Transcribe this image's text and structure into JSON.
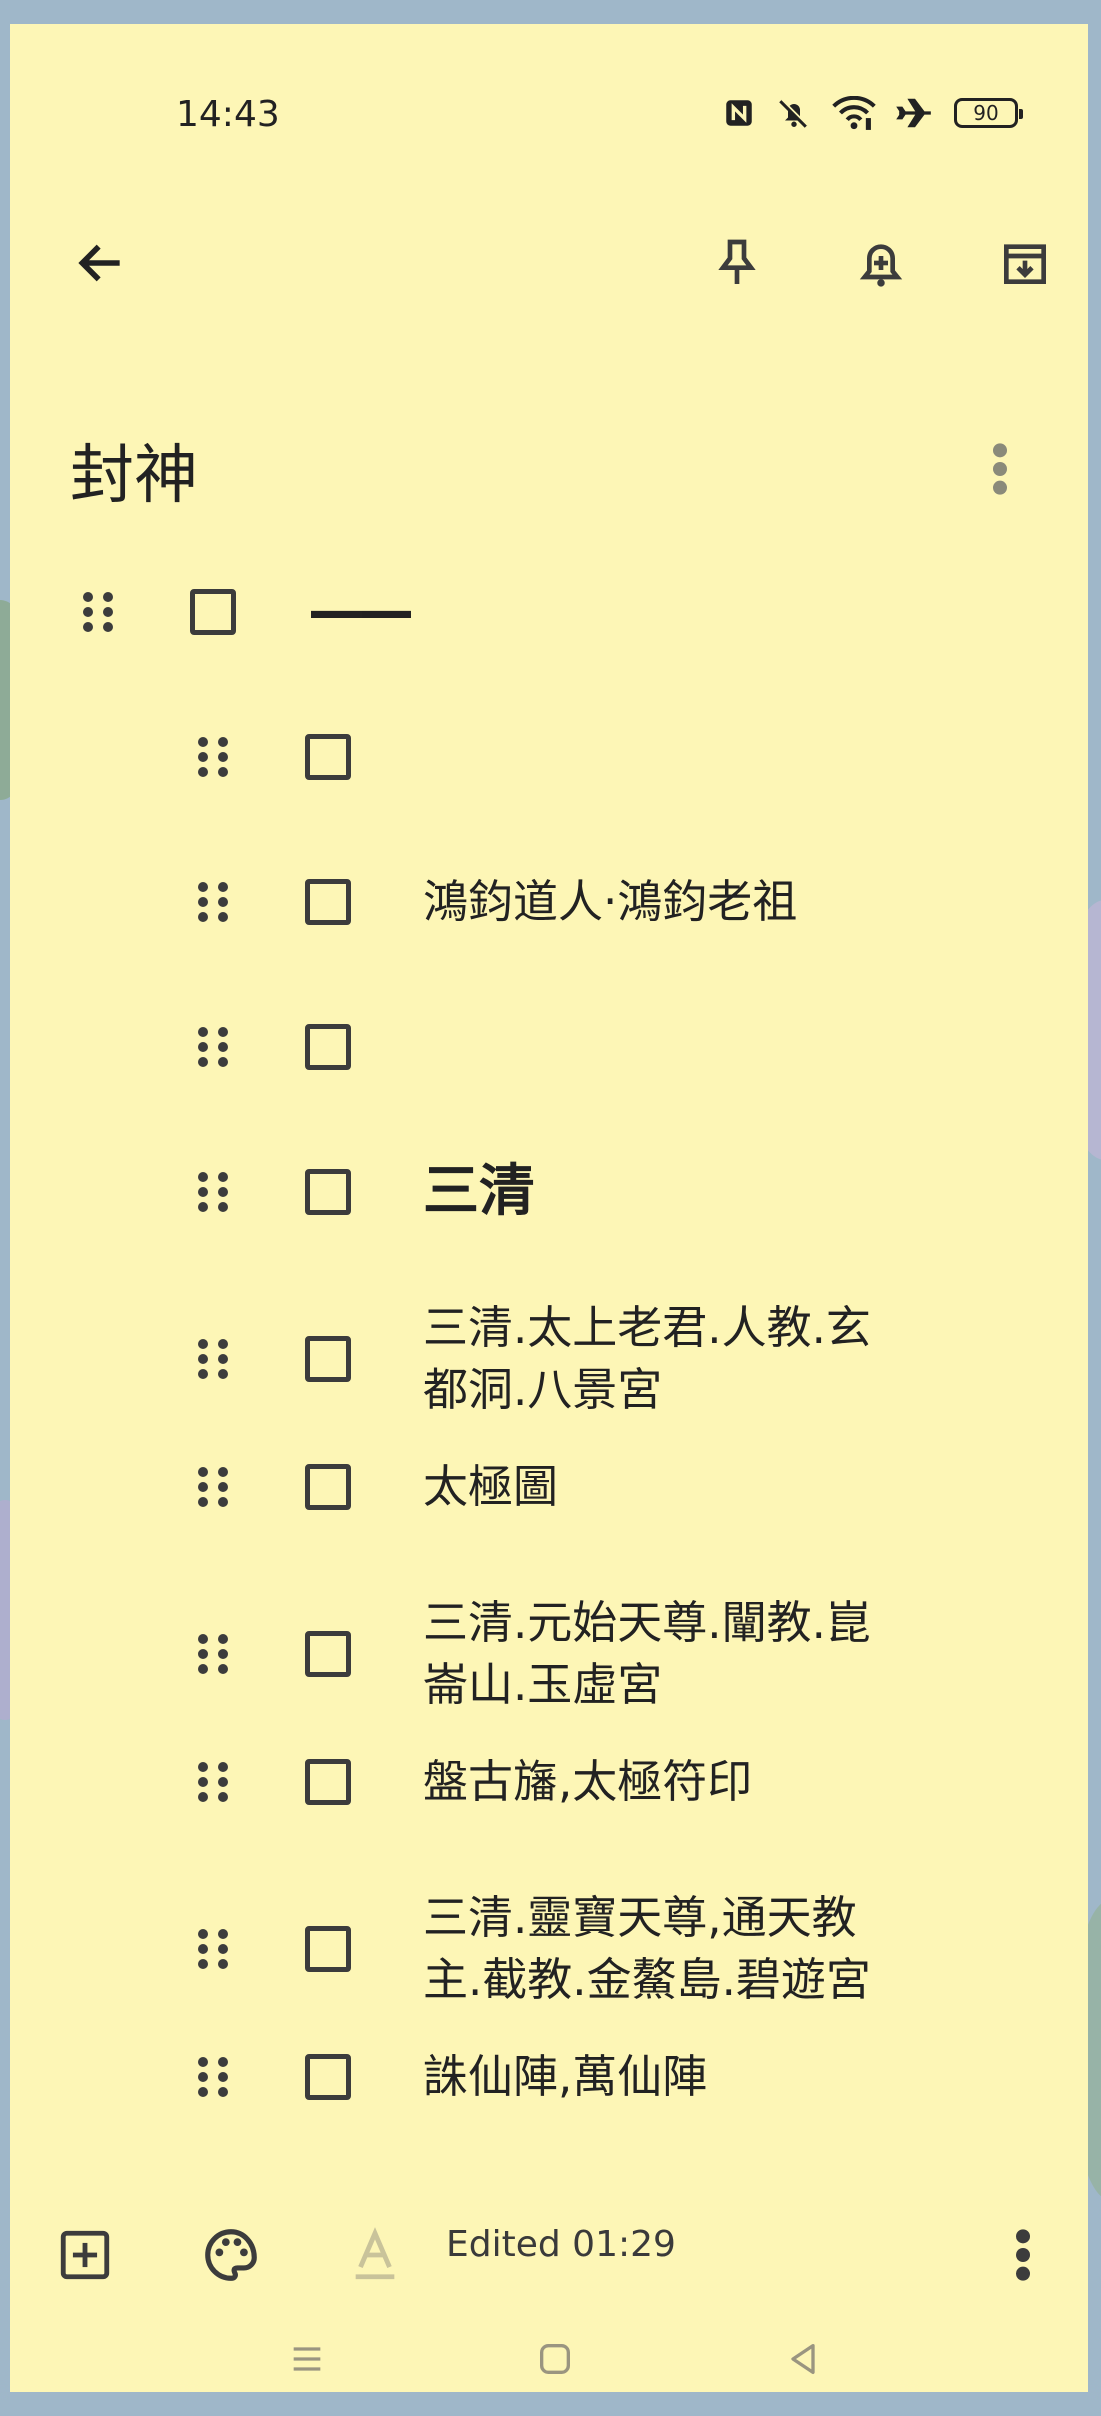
{
  "status_bar": {
    "time": "14:43",
    "battery": "90",
    "icons": [
      "nfc-icon",
      "bell-muted-icon",
      "wifi-icon",
      "airplane-icon",
      "battery-icon"
    ]
  },
  "toolbar": {
    "icons": [
      "back-arrow-icon",
      "pin-icon",
      "add-reminder-icon",
      "archive-icon"
    ]
  },
  "note": {
    "title": "封神",
    "items": [
      {
        "text": "——",
        "level": 0,
        "checked": false
      },
      {
        "text": "",
        "level": 1,
        "checked": false
      },
      {
        "text": "鴻鈞道人·鴻鈞老祖",
        "level": 1,
        "checked": false
      },
      {
        "text": "",
        "level": 1,
        "checked": false
      },
      {
        "text": "三清",
        "level": 1,
        "checked": false
      },
      {
        "text": "三清.太上老君.人教.玄\n都洞.八景宮",
        "level": 1,
        "checked": false
      },
      {
        "text": "太極圖",
        "level": 1,
        "checked": false
      },
      {
        "text": "三清.元始天尊.闡教.崑\n崙山.玉虛宮",
        "level": 1,
        "checked": false
      },
      {
        "text": "盤古旛,太極符印",
        "level": 1,
        "checked": false
      },
      {
        "text": "三清.靈寶天尊,通天教\n主.截教.金鰲島.碧遊宮",
        "level": 1,
        "checked": false
      },
      {
        "text": "誅仙陣,萬仙陣",
        "level": 1,
        "checked": false
      }
    ]
  },
  "bottom_bar": {
    "edited": "Edited 01:29",
    "icons": [
      "add-box-icon",
      "palette-icon",
      "text-format-icon",
      "more-vert-icon"
    ]
  },
  "nav_bar": {
    "icons": [
      "recents-icon",
      "home-icon",
      "back-triangle-icon"
    ]
  },
  "colors": {
    "note_background": "#fdf6b6",
    "text": "#222222",
    "icon": "#3c3c3c"
  }
}
